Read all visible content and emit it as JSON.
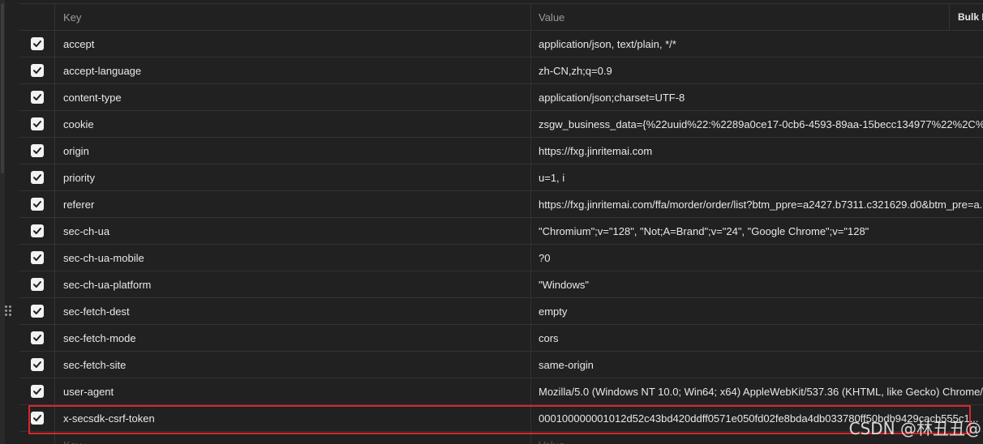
{
  "header": {
    "key_label": "Key",
    "value_label": "Value",
    "bulk_label": "Bulk Edit"
  },
  "rows": [
    {
      "key": "accept",
      "value": "application/json, text/plain, */*"
    },
    {
      "key": "accept-language",
      "value": "zh-CN,zh;q=0.9"
    },
    {
      "key": "content-type",
      "value": "application/json;charset=UTF-8"
    },
    {
      "key": "cookie",
      "value": "zsgw_business_data={%22uuid%22:%2289a0ce17-0cb6-4593-89aa-15becc134977%22%2C%..."
    },
    {
      "key": "origin",
      "value": "https://fxg.jinritemai.com"
    },
    {
      "key": "priority",
      "value": "u=1, i"
    },
    {
      "key": "referer",
      "value": "https://fxg.jinritemai.com/ffa/morder/order/list?btm_ppre=a2427.b7311.c321629.d0&btm_pre=a..."
    },
    {
      "key": "sec-ch-ua",
      "value": "\"Chromium\";v=\"128\", \"Not;A=Brand\";v=\"24\", \"Google Chrome\";v=\"128\""
    },
    {
      "key": "sec-ch-ua-mobile",
      "value": "?0"
    },
    {
      "key": "sec-ch-ua-platform",
      "value": "\"Windows\""
    },
    {
      "key": "sec-fetch-dest",
      "value": "empty"
    },
    {
      "key": "sec-fetch-mode",
      "value": "cors"
    },
    {
      "key": "sec-fetch-site",
      "value": "same-origin"
    },
    {
      "key": "user-agent",
      "value": "Mozilla/5.0 (Windows NT 10.0; Win64; x64) AppleWebKit/537.36 (KHTML, like Gecko) Chrome/1..."
    },
    {
      "key": "x-secsdk-csrf-token",
      "value": "000100000001012d52c43bd420ddff0571e050fd02fe8bda4db033780ff50bdb9429cacb555c1..."
    }
  ],
  "new_row": {
    "key_placeholder": "Key",
    "value_placeholder": "Value"
  },
  "watermark": "CSDN @林丑丑@",
  "colors": {
    "background": "#212121",
    "border": "#333333",
    "highlight": "#d9262c"
  }
}
